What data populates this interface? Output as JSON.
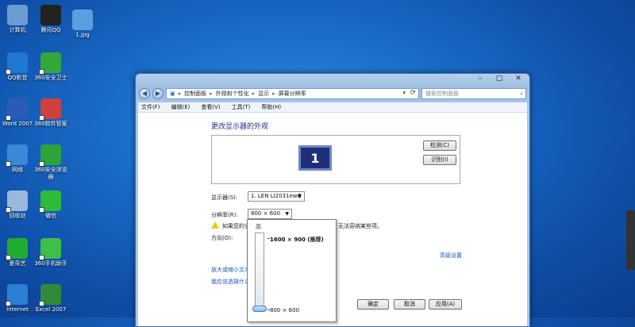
{
  "desktop_icons": [
    {
      "label": "计算机",
      "icon": "computer-icon",
      "color": "#6c9bd2"
    },
    {
      "label": "腾讯QQ",
      "icon": "qq-icon",
      "color": "#222222"
    },
    {
      "label": "1.jpg",
      "icon": "image-file-icon",
      "color": "#5aa0e0"
    },
    {
      "label": "QQ影音",
      "icon": "qq-player-icon",
      "color": "#1f78d1"
    },
    {
      "label": "360安全卫士",
      "icon": "360-safe-icon",
      "color": "#33a83a"
    },
    {
      "label": "Word 2007",
      "icon": "word-icon",
      "color": "#2a5bb8"
    },
    {
      "label": "360软件管家",
      "icon": "360-software-icon",
      "color": "#d04040"
    },
    {
      "label": "网络",
      "icon": "network-icon",
      "color": "#3b88d8"
    },
    {
      "label": "360安全浏览器",
      "icon": "360-browser-icon",
      "color": "#2fa23a"
    },
    {
      "label": "回收站",
      "icon": "recycle-bin-icon",
      "color": "#9ab8d8"
    },
    {
      "label": "微信",
      "icon": "wechat-icon",
      "color": "#2dbb3a"
    },
    {
      "label": "爱奇艺",
      "icon": "iqiyi-icon",
      "color": "#1fae2f"
    },
    {
      "label": "360手机助手",
      "icon": "360-phone-icon",
      "color": "#3fbf4a"
    },
    {
      "label": "Internet",
      "icon": "ie-icon",
      "color": "#2a7fd6"
    },
    {
      "label": "Excel 2007",
      "icon": "excel-icon",
      "color": "#2f8a3a"
    }
  ],
  "window": {
    "controls": [
      "–",
      "□",
      "✕"
    ],
    "breadcrumb": [
      "控制面板",
      "外观和个性化",
      "显示",
      "屏幕分辨率"
    ],
    "search_placeholder": "搜索控制面板",
    "menu": [
      "文件(F)",
      "编辑(E)",
      "查看(V)",
      "工具(T)",
      "帮助(H)"
    ],
    "page_title": "更改显示器的外观",
    "monitor_number": "1",
    "detect_button": "检测(C)",
    "identify_button": "识别(I)",
    "display_label": "显示器(S):",
    "display_value": "1. LEN LI2031ewC",
    "resolution_label": "分辨率(R):",
    "resolution_value": "800 × 600",
    "warning_text_start": "如果您的分",
    "warning_text_end": "无法容纳某些项。",
    "orientation_label": "方向(O):",
    "advanced_link": "高级设置",
    "link_text_size": "放大或缩小文本",
    "link_help": "我应该选择什么",
    "ok_button": "确定",
    "cancel_button": "取消",
    "apply_button": "应用(A)"
  },
  "resolution_dropdown": {
    "high_label": "高",
    "top_option": "1600 × 900 (推荐)",
    "bottom_option": "800 × 600"
  }
}
